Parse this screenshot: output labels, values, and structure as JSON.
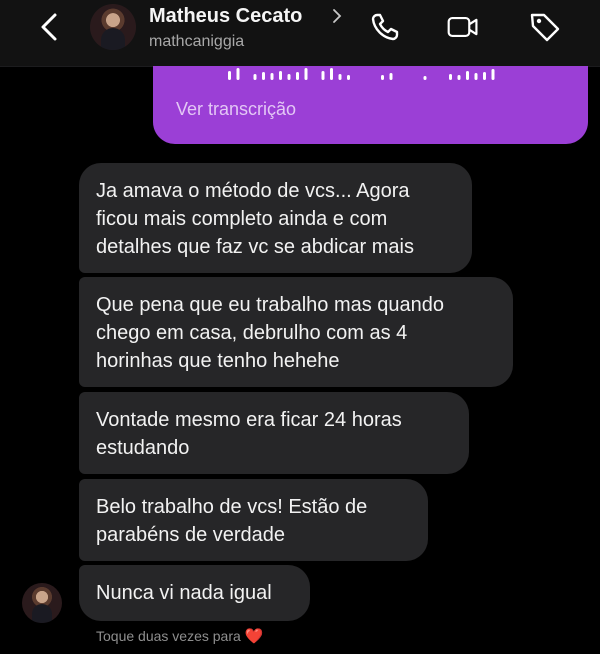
{
  "header": {
    "name": "Matheus Cecato",
    "username": "mathcaniggia",
    "icons": [
      "back-icon",
      "chevron-right-icon",
      "phone-icon",
      "video-icon",
      "tag-icon"
    ]
  },
  "voice_message": {
    "transcript_label": "Ver transcrição"
  },
  "messages": [
    {
      "lines": [
        "Ja amava o método de vcs... Agora",
        "ficou mais completo ainda e com",
        "detalhes que faz vc se abdicar mais"
      ]
    },
    {
      "lines": [
        "Que pena que eu trabalho mas quando",
        "chego em casa, debrulho com as 4",
        "horinhas que tenho hehehe"
      ]
    },
    {
      "lines": [
        "Vontade mesmo era ficar 24 horas",
        "estudando"
      ]
    },
    {
      "lines": [
        "Belo trabalho de vcs! Estão de",
        "parabéns de verdade"
      ]
    },
    {
      "lines": [
        "Nunca vi nada igual"
      ]
    }
  ],
  "hint": {
    "text": "Toque duas vezes para",
    "emoji": "❤️"
  },
  "colors": {
    "background": "#000000",
    "header": "#121212",
    "incoming_bubble": "#262628",
    "outgoing_bubble": "#9b3fd6",
    "heart": "#ff3040"
  }
}
